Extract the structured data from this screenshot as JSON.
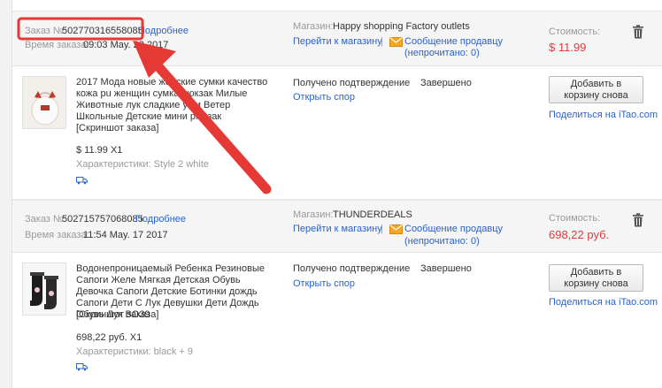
{
  "orders": [
    {
      "order_label": "Заказ №:",
      "order_number": "502770316558085",
      "details_link": "Подробнее",
      "time_label": "Время заказа:",
      "time_value": "09:03 May. 22 2017",
      "store_label": "Магазин:",
      "store_name": "Happy shopping Factory outlets",
      "go_to_store": "Перейти к магазину",
      "separator": "|",
      "message_seller": "Сообщение продавцу",
      "unread": "(непрочитано: 0)",
      "cost_label": "Стоимость:",
      "cost_value": "$ 11.99",
      "item": {
        "title": "2017 Мода новые женские сумки качество кожа pu женщин сумка рюкзак Милые Животные лук сладкие уши Ветер Школьные Детские мини рюкзак",
        "snapshot": "[Скриншот заказа]",
        "price_qty": "$ 11.99 X1",
        "specs": "Характеристики: Style 2 white",
        "delivery_status": "Получено подтверждение",
        "open_dispute": "Открыть спор",
        "order_status": "Завершено",
        "add_to_cart": "Добавить в корзину снова",
        "share_prefix": "Поделиться на",
        "share_site": "iTao.com"
      }
    },
    {
      "order_label": "Заказ №:",
      "order_number": "502715757068085",
      "details_link": "Подробнее",
      "time_label": "Время заказа:",
      "time_value": "11:54 May. 17 2017",
      "store_label": "Магазин:",
      "store_name": "THUNDERDEALS",
      "go_to_store": "Перейти к магазину",
      "separator": "|",
      "message_seller": "Сообщение продавцу",
      "unread": "(непрочитано: 0)",
      "cost_label": "Стоимость:",
      "cost_value": "698,22 руб.",
      "item": {
        "title": "Водонепроницаемый Ребенка Резиновые Сапоги Желе Мягкая Детская Обувь Девочка Сапоги Детские Ботинки дождь Сапоги Дети С Лук Девушки Дети Дождь Обувь Лук BO39",
        "snapshot": "[Скриншот заказа]",
        "price_qty": "698,22 руб. X1",
        "specs": "Характеристики: black + 9",
        "delivery_status": "Получено подтверждение",
        "open_dispute": "Открыть спор",
        "order_status": "Завершено",
        "add_to_cart": "Добавить в корзину снова",
        "share_prefix": "Поделиться на",
        "share_site": "iTao.com"
      }
    }
  ],
  "icons": {
    "trash": "trash-icon",
    "mail": "envelope-icon",
    "truck": "truck-icon"
  },
  "colors": {
    "link": "#2a62c8",
    "price": "#e4393c",
    "annotation": "#e53935",
    "mail": "#f5a623"
  }
}
